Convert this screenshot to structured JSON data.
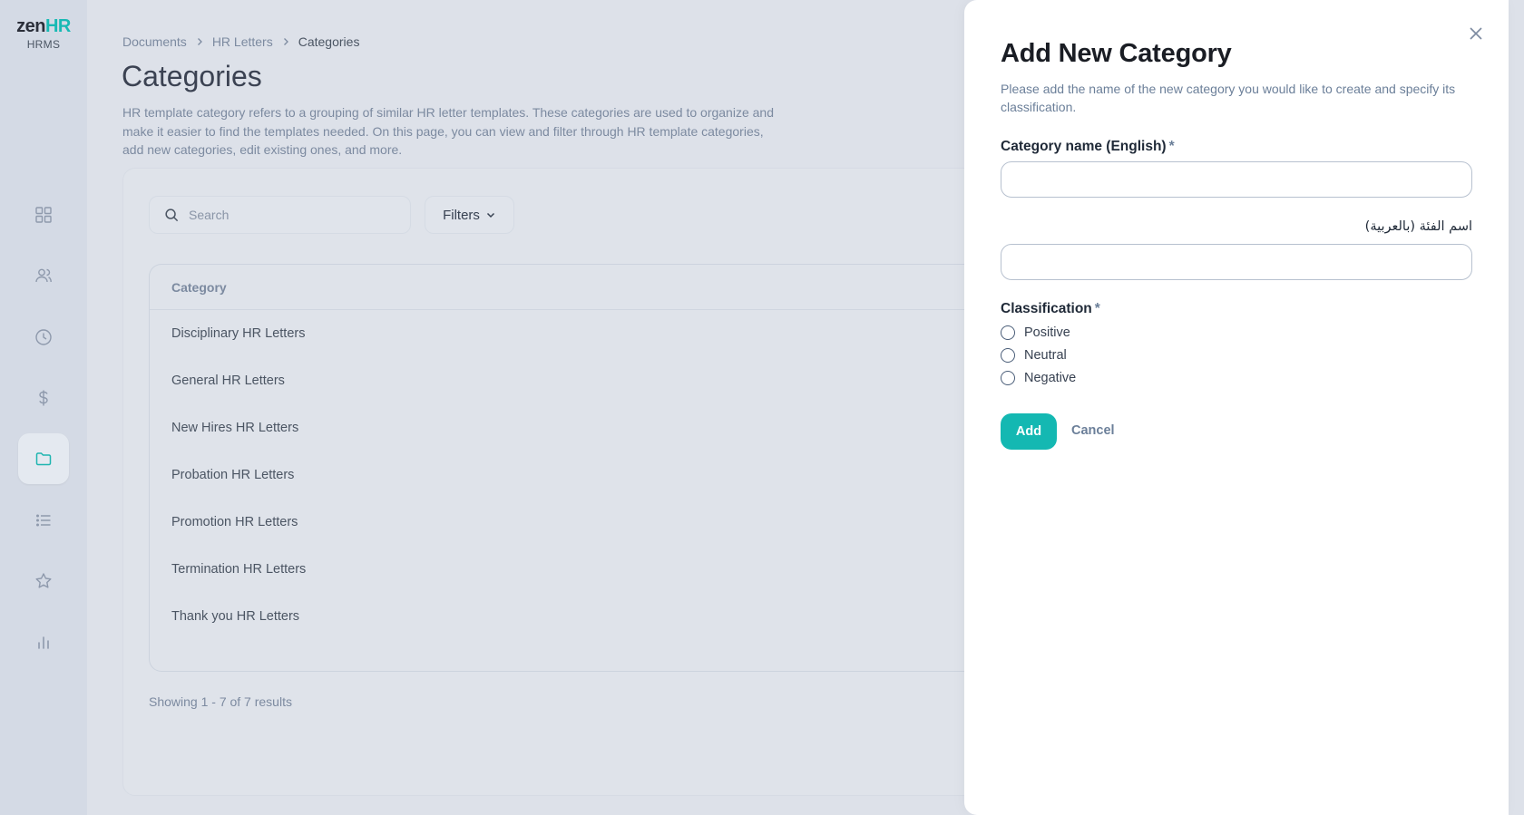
{
  "logo": {
    "word_zen": "zen",
    "word_hr": "HR",
    "sub": "HRMS"
  },
  "nav": [
    {
      "icon": "grid-icon",
      "active": false
    },
    {
      "icon": "users-icon",
      "active": false
    },
    {
      "icon": "clock-icon",
      "active": false
    },
    {
      "icon": "dollar-icon",
      "active": false
    },
    {
      "icon": "folder-icon",
      "active": true
    },
    {
      "icon": "list-icon",
      "active": false
    },
    {
      "icon": "star-icon",
      "active": false
    },
    {
      "icon": "bar-chart-icon",
      "active": false
    }
  ],
  "breadcrumb": {
    "items": [
      "Documents",
      "HR Letters"
    ],
    "current": "Categories"
  },
  "page": {
    "title": "Categories",
    "description": "HR template category refers to a grouping of similar HR letter templates. These categories are used to organize and make it easier to find the templates needed. On this page, you can view and filter through HR template categories, add new categories, edit existing ones, and more."
  },
  "toolbar": {
    "search_placeholder": "Search",
    "filters_label": "Filters"
  },
  "table": {
    "header": "Category",
    "rows": [
      "Disciplinary HR Letters",
      "General HR Letters",
      "New Hires HR Letters",
      "Probation HR Letters",
      "Promotion HR Letters",
      "Termination HR Letters",
      "Thank you HR Letters"
    ]
  },
  "results_text": "Showing 1 - 7 of 7 results",
  "drawer": {
    "title": "Add New Category",
    "description": "Please add the name of the new category you would like to create and specify its classification.",
    "name_en_label": "Category name (English)",
    "name_ar_label": "اسم الفئة (بالعربية)",
    "required_mark": "*",
    "name_en_value": "",
    "name_ar_value": "",
    "classification_label": "Classification",
    "options": [
      "Positive",
      "Neutral",
      "Negative"
    ],
    "add_label": "Add",
    "cancel_label": "Cancel"
  },
  "colors": {
    "accent": "#14b8b2",
    "muted": "#6b7f99",
    "rail": "#d4dae5",
    "backdrop": "#dde1e9"
  }
}
